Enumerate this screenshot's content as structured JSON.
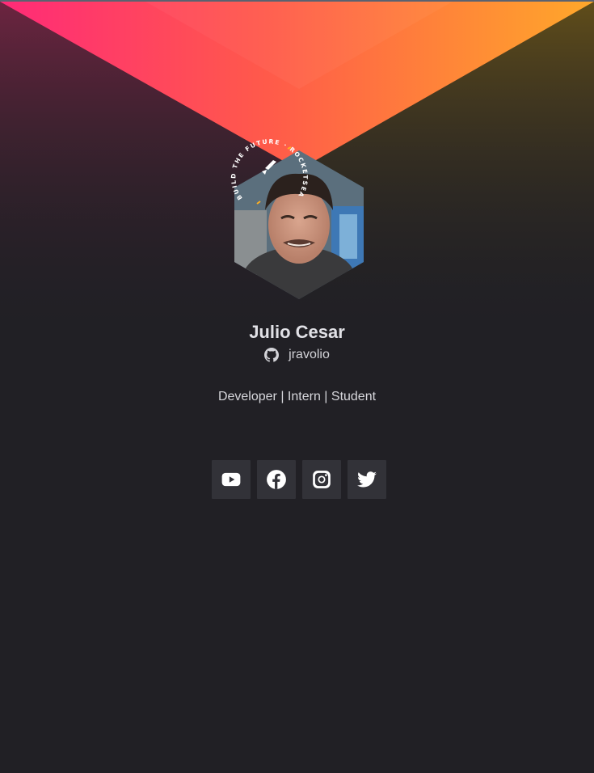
{
  "profile": {
    "name": "Julio Cesar",
    "github_username": "jravolio",
    "bio": "Developer | Intern | Student",
    "badge_text": "BUILD THE FUTURE · ROCKETSEAT ·"
  },
  "socials": [
    {
      "icon": "youtube-icon",
      "label": "YouTube"
    },
    {
      "icon": "facebook-icon",
      "label": "Facebook"
    },
    {
      "icon": "instagram-icon",
      "label": "Instagram"
    },
    {
      "icon": "twitter-icon",
      "label": "Twitter"
    }
  ],
  "colors": {
    "background": "#212025",
    "gradient_start": "#ff2d75",
    "gradient_end": "#ffa62b",
    "button_bg": "#323238",
    "text": "#e1e1e6"
  }
}
